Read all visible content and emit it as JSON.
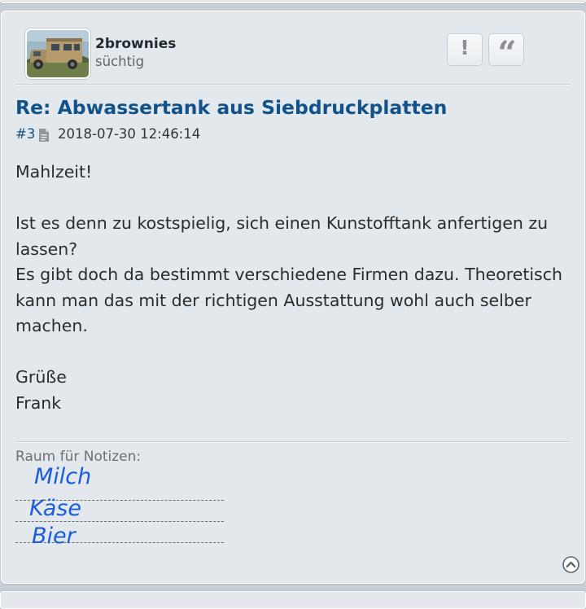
{
  "post": {
    "username": "2brownies",
    "rank": "süchtig",
    "title": "Re: Abwassertank aus Siebdruckplatten",
    "post_number": "#3",
    "timestamp": "2018-07-30 12:46:14",
    "body": {
      "greeting": "Mahlzeit!",
      "p1": "Ist es denn zu kostspielig, sich einen Kunstofftank anfertigen zu lassen?",
      "p2": "Es gibt doch da bestimmt verschiedene Firmen dazu. Theoretisch kann man das mit der richtigen Ausstattung wohl auch selber machen.",
      "closing": "Grüße",
      "name": "Frank"
    },
    "signature": {
      "label": "Raum für Notizen:",
      "notes": [
        "Milch",
        "Käse",
        "Bier"
      ]
    }
  },
  "icons": {
    "report": "exclamation-icon",
    "quote": "quote-icon",
    "post_link": "document-icon",
    "back_to_top": "chevron-up-circle-icon"
  },
  "colors": {
    "link": "#105289",
    "panel": "#e3e8ec",
    "note_ink": "#1a5ddb"
  }
}
